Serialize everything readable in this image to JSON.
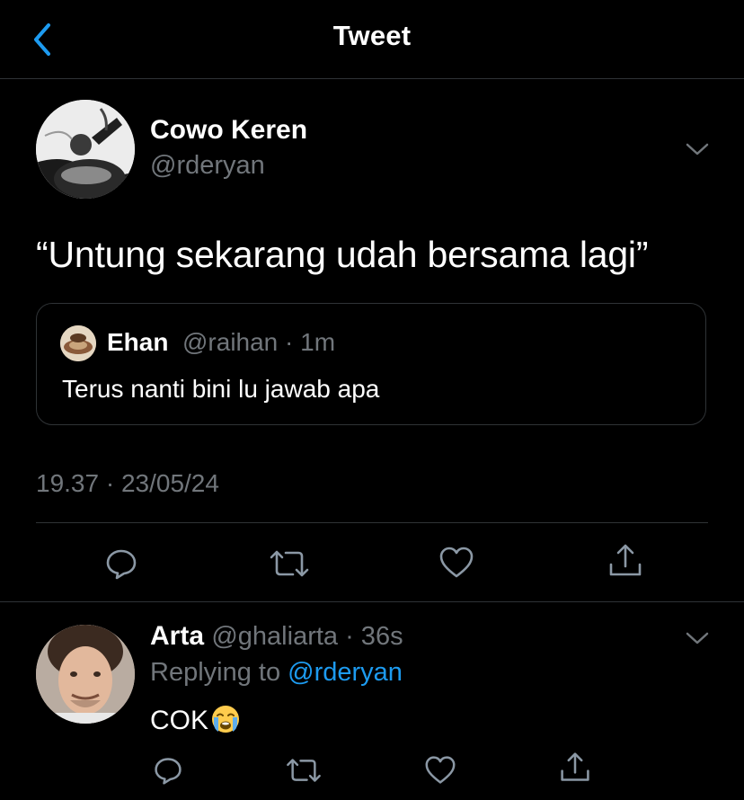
{
  "header": {
    "title": "Tweet",
    "back_icon": "chevron-left-icon"
  },
  "main_tweet": {
    "author_name": "Cowo Keren",
    "author_handle": "@rderyan",
    "text": "“Untung sekarang udah bersama lagi”",
    "quote": {
      "name": "Ehan",
      "meta": "@raihan · 1m",
      "text": "Terus nanti bini lu jawab apa"
    },
    "timestamp": "19.37 · 23/05/24",
    "actions": [
      "reply-icon",
      "retweet-icon",
      "like-icon",
      "share-icon"
    ]
  },
  "reply": {
    "name": "Arta",
    "meta": "@ghaliarta · 36s",
    "replying_prefix": "Replying to ",
    "replying_to": "@rderyan",
    "text": "COK",
    "emoji_icon": "loudly-crying-face-icon",
    "actions": [
      "reply-icon",
      "retweet-icon",
      "like-icon",
      "share-icon"
    ]
  },
  "colors": {
    "background": "#000000",
    "text": "#ffffff",
    "muted": "#71767b",
    "accent": "#1d9bf0",
    "border": "#2f3336"
  }
}
